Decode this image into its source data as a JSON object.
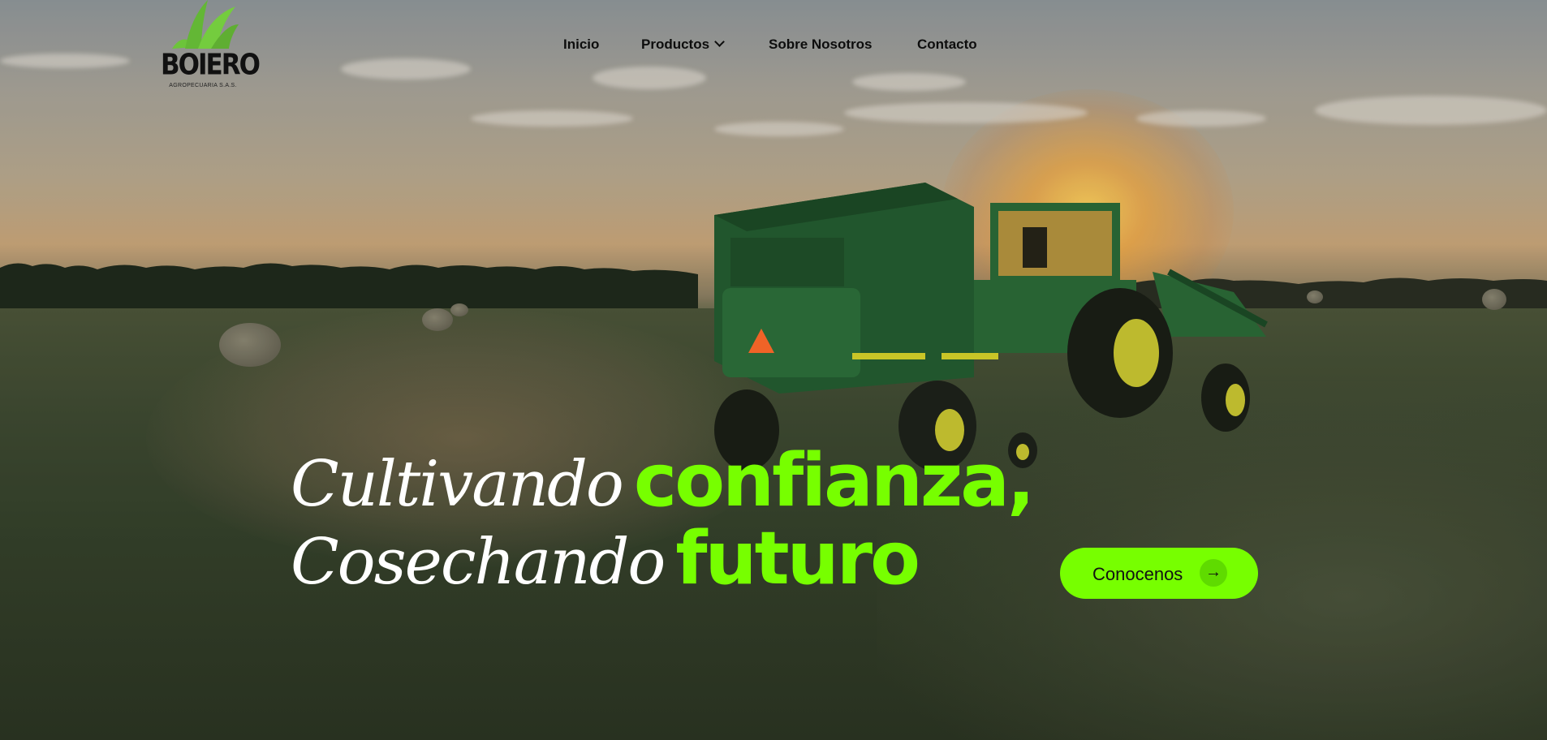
{
  "brand": {
    "name": "BOIERO",
    "tagline": "AGROPECUARIA S.A.S.",
    "accent_color": "#77ff00"
  },
  "nav": {
    "items": [
      {
        "label": "Inicio"
      },
      {
        "label": "Productos",
        "icon": "chevron-down-icon"
      },
      {
        "label": "Sobre Nosotros"
      },
      {
        "label": "Contacto"
      }
    ]
  },
  "hero": {
    "line1_script": "Cultivando",
    "line1_bold": "confianza,",
    "line2_script": "Cosechando",
    "line2_bold": "futuro",
    "cta_label": "Conocenos",
    "cta_icon": "arrow-right-icon",
    "background_image": "tractor-field-sunset"
  }
}
